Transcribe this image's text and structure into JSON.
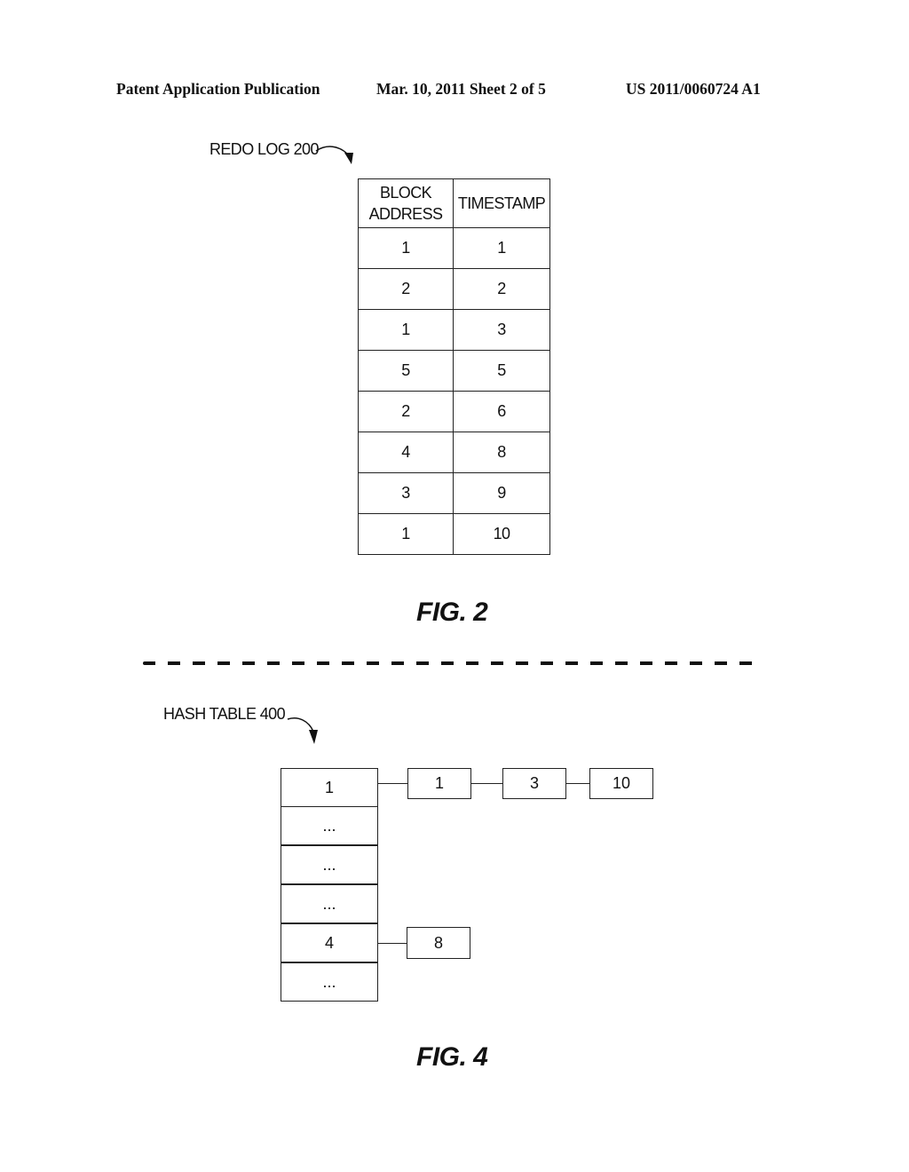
{
  "header": {
    "publication": "Patent Application Publication",
    "date_sheet": "Mar. 10, 2011  Sheet 2 of 5",
    "number": "US 2011/0060724 A1"
  },
  "fig2": {
    "label": "REDO LOG 200",
    "caption": "FIG. 2",
    "columns": [
      "BLOCK ADDRESS",
      "TIMESTAMP"
    ],
    "column_lines": [
      [
        "BLOCK",
        "ADDRESS"
      ],
      [
        "TIMESTAMP"
      ]
    ],
    "rows": [
      [
        "1",
        "1"
      ],
      [
        "2",
        "2"
      ],
      [
        "1",
        "3"
      ],
      [
        "5",
        "5"
      ],
      [
        "2",
        "6"
      ],
      [
        "4",
        "8"
      ],
      [
        "3",
        "9"
      ],
      [
        "1",
        "10"
      ]
    ]
  },
  "fig4": {
    "label": "HASH TABLE 400",
    "caption": "FIG. 4",
    "buckets": [
      "1",
      "...",
      "...",
      "...",
      "4",
      "..."
    ],
    "chains": {
      "bucket_1": [
        "1",
        "3",
        "10"
      ],
      "bucket_4": [
        "8"
      ]
    }
  }
}
